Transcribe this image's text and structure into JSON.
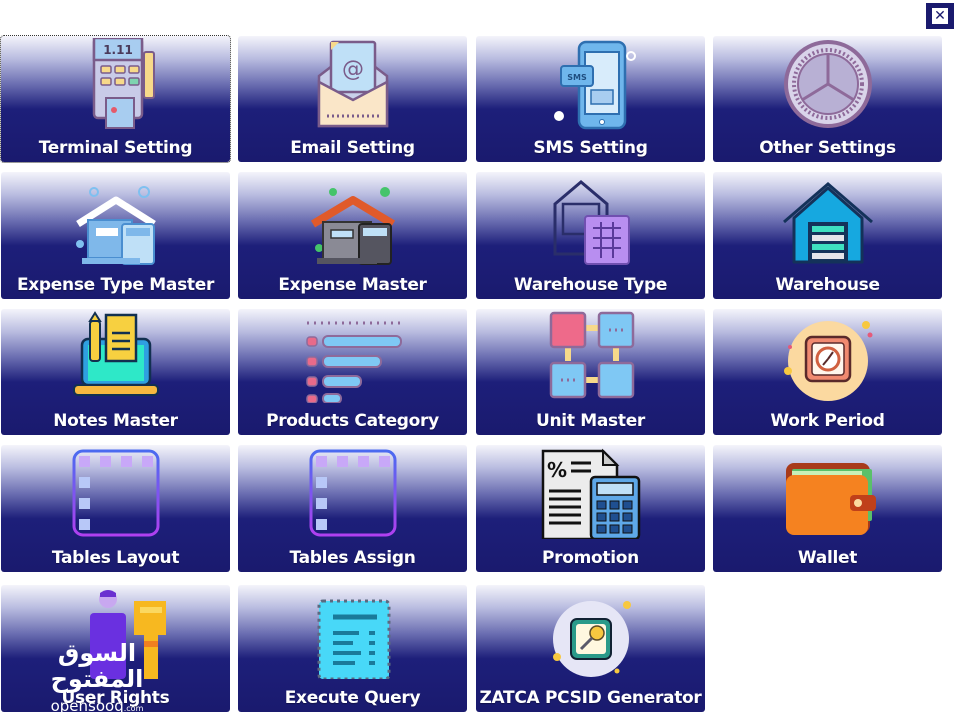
{
  "window": {
    "close_icon": "close-icon"
  },
  "tiles": [
    {
      "label": "Terminal Setting",
      "icon": "payment-terminal-icon"
    },
    {
      "label": "Email Setting",
      "icon": "email-envelope-icon"
    },
    {
      "label": "SMS Setting",
      "icon": "sms-phone-icon"
    },
    {
      "label": "Other Settings",
      "icon": "gear-icon"
    },
    {
      "label": "Expense Type Master",
      "icon": "house-calculator-icon"
    },
    {
      "label": "Expense Master",
      "icon": "house-calculator-icon"
    },
    {
      "label": "Warehouse Type",
      "icon": "warehouse-pallet-icon"
    },
    {
      "label": "Warehouse",
      "icon": "warehouse-icon"
    },
    {
      "label": "Notes Master",
      "icon": "laptop-notes-icon"
    },
    {
      "label": "Products Category",
      "icon": "category-list-icon"
    },
    {
      "label": "Unit Master",
      "icon": "unit-blocks-icon"
    },
    {
      "label": "Work Period",
      "icon": "clock-icon"
    },
    {
      "label": "Tables Layout",
      "icon": "table-grid-icon"
    },
    {
      "label": "Tables Assign",
      "icon": "table-grid-icon"
    },
    {
      "label": "Promotion",
      "icon": "promotion-calculator-icon"
    },
    {
      "label": "Wallet",
      "icon": "wallet-icon"
    },
    {
      "label": "User Rights",
      "icon": "user-key-icon"
    },
    {
      "label": "Execute Query",
      "icon": "query-document-icon"
    },
    {
      "label": "ZATCA PCSID Generator",
      "icon": "key-icon"
    }
  ],
  "terminal_display": "1.11",
  "sms_badge": "SMS",
  "watermark": {
    "arabic": "السوق المفتوح",
    "latin": "opensooq",
    "suffix": ".com"
  }
}
